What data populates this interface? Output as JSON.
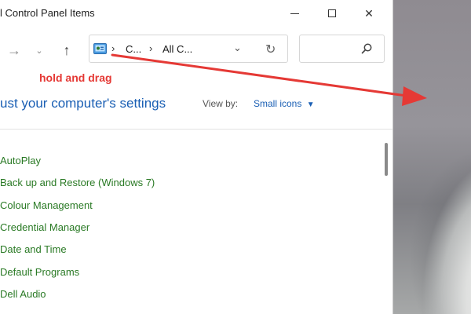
{
  "window": {
    "title": "l Control Panel Items",
    "min_icon": "minimize-icon",
    "max_icon": "maximize-icon",
    "close_icon": "close-icon",
    "close_glyph": "✕"
  },
  "nav": {
    "forward_glyph": "→",
    "recent_glyph": "⌄",
    "up_glyph": "↑"
  },
  "address": {
    "sep1": "›",
    "crumb1": "C...",
    "sep2": "›",
    "crumb2": "All C...",
    "dropdown_glyph": "⌄",
    "refresh_glyph": "↻"
  },
  "search": {
    "placeholder": "",
    "icon": "search-icon"
  },
  "content": {
    "heading": "ust your computer's settings",
    "view_by_label": "View by:",
    "view_by_value": "Small icons",
    "view_by_caret": "▼",
    "items": [
      "AutoPlay",
      "Back up and Restore (Windows 7)",
      "Colour Management",
      "Credential Manager",
      "Date and Time",
      "Default Programs",
      "Dell Audio"
    ]
  },
  "annotation": {
    "text": "hold and drag",
    "color": "#e53935"
  },
  "colors": {
    "link_blue": "#1a5fb4",
    "item_green": "#2a7a25"
  }
}
